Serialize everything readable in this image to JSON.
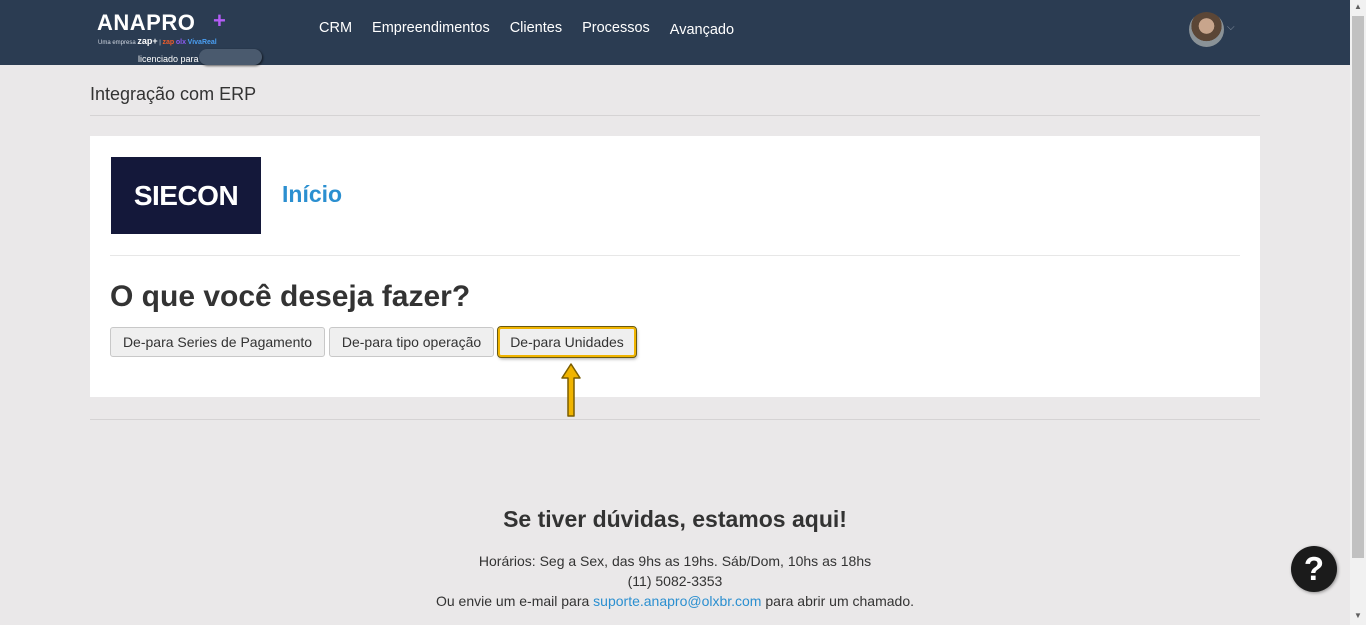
{
  "brand": {
    "logo_text": "ANAPRO",
    "logo_plus": "+",
    "sub_prefix": "Uma empresa",
    "sub_zap": "zap+",
    "sub_brand1": "zap",
    "sub_brand2": "olx",
    "sub_brand3": "VivaReal",
    "license_label": "licenciado para"
  },
  "nav": {
    "items": [
      "CRM",
      "Empreendimentos",
      "Clientes",
      "Processos",
      "Avançado"
    ]
  },
  "page": {
    "title": "Integração com ERP"
  },
  "panel": {
    "logo_text": "SIECON",
    "heading": "Início",
    "question": "O que você deseja fazer?",
    "buttons": [
      "De-para Series de Pagamento",
      "De-para tipo operação",
      "De-para Unidades"
    ]
  },
  "footer": {
    "title": "Se tiver dúvidas, estamos aqui!",
    "hours": "Horários: Seg a Sex, das 9hs as 19hs. Sáb/Dom, 10hs as 18hs",
    "phone": "(11) 5082-3353",
    "email_prefix": "Ou envie um e-mail para",
    "email": "suporte.anapro@olxbr.com",
    "email_suffix": "para abrir um chamado."
  },
  "help": {
    "icon_char": "?"
  },
  "colors": {
    "topbar": "#2b3c52",
    "accent": "#2b8fd0",
    "highlight": "#f0b400",
    "logo_plus": "#b35cf5"
  }
}
